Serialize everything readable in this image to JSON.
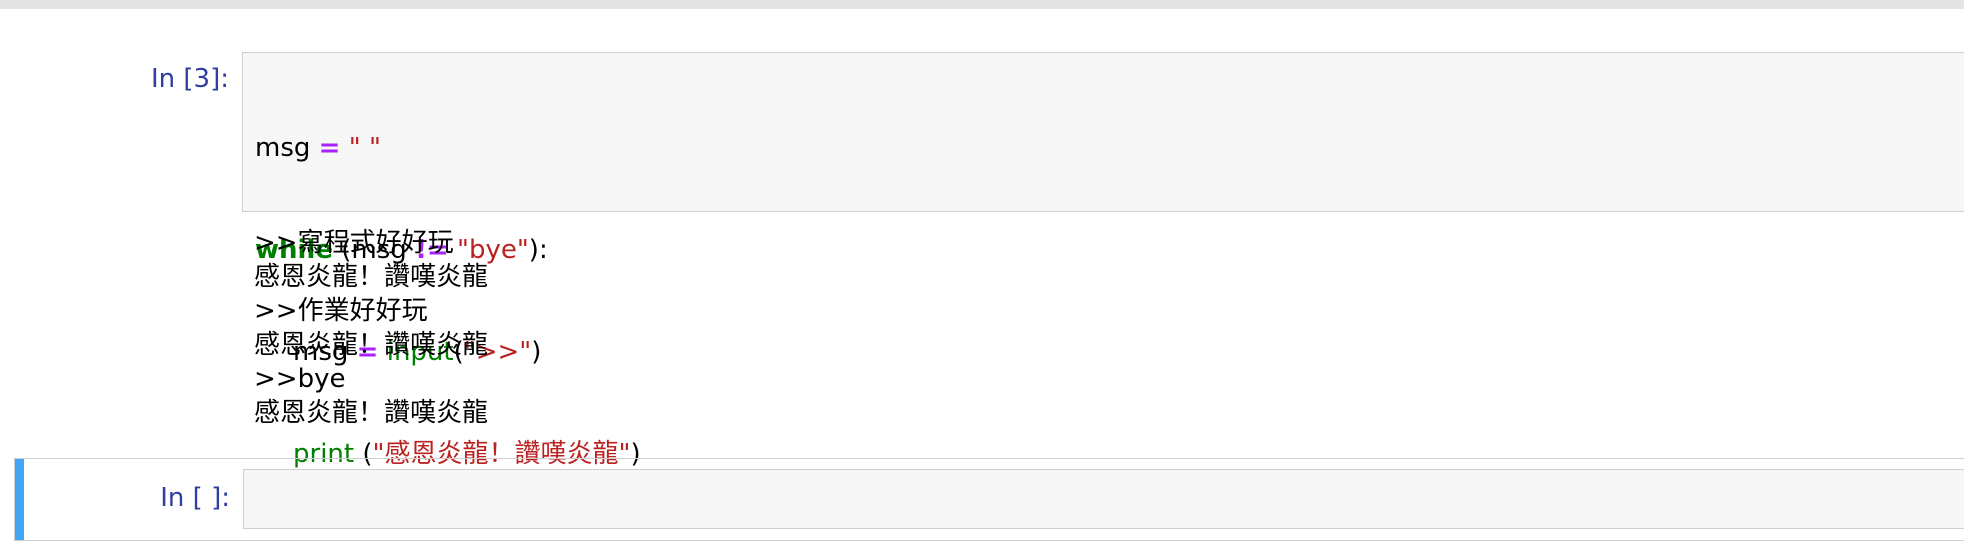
{
  "cells": [
    {
      "prompt": "In [3]:",
      "code": {
        "line1": {
          "var": "msg",
          "op": "=",
          "str": "\" \""
        },
        "line2": {
          "kw": "while",
          "open": "(msg",
          "op": "!=",
          "str": "\"bye\"",
          "close": "):"
        },
        "line3": {
          "var": "msg",
          "op": "=",
          "fn": "input",
          "open": "(",
          "str": "\">>\"",
          "close": ")"
        },
        "line4": {
          "fn": "print",
          "open": "(",
          "str": "\"感恩炎龍！讚嘆炎龍\"",
          "close": ")"
        }
      },
      "output": [
        ">>寫程式好好玩",
        "感恩炎龍！讚嘆炎龍",
        ">>作業好好玩",
        "感恩炎龍！讚嘆炎龍",
        ">>bye",
        "感恩炎龍！讚嘆炎龍"
      ]
    },
    {
      "prompt": "In [ ]:",
      "code": ""
    }
  ],
  "colors": {
    "prompt": "#303f9f",
    "keyword": "#008000",
    "operator": "#aa22ff",
    "string": "#ba2121",
    "selected_cell_bar": "#42a5f5"
  }
}
